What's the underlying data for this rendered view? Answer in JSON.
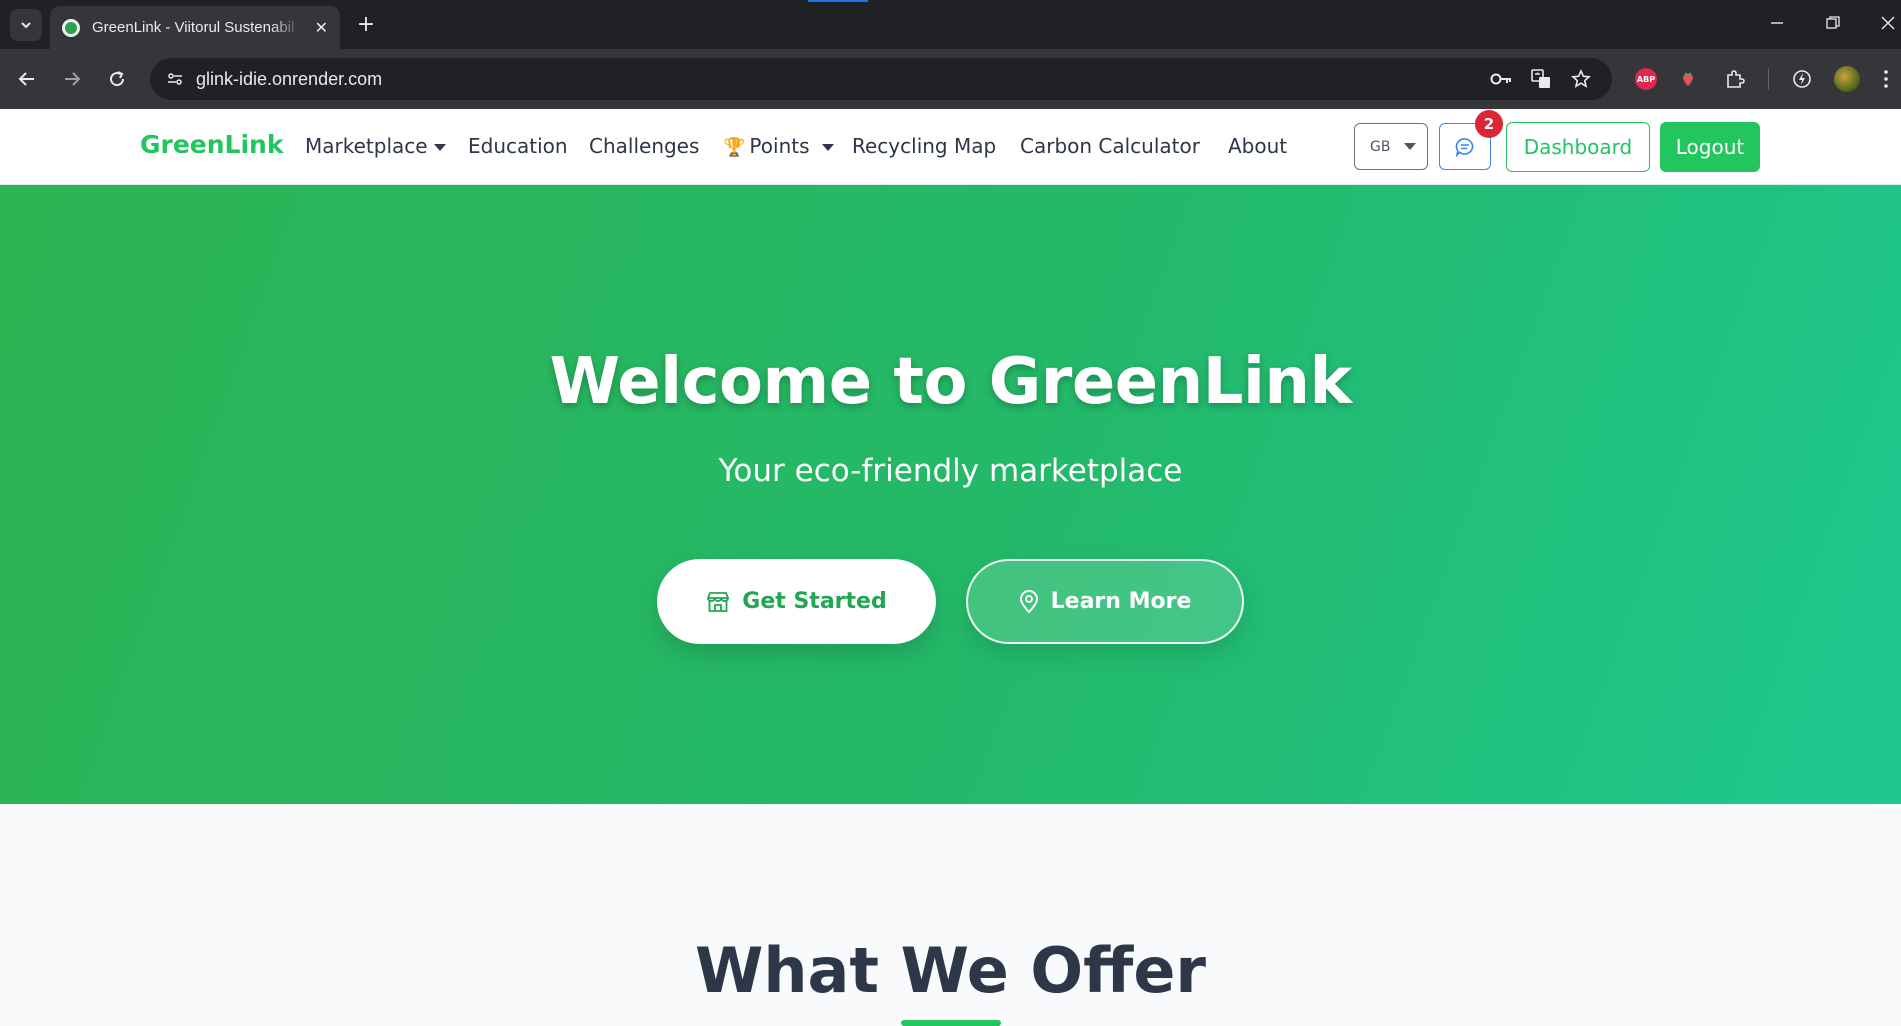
{
  "browser": {
    "tab_title": "GreenLink - Viitorul Sustenabil",
    "tab_close": "✕",
    "new_tab": "+",
    "url": "glink-idie.onrender.com",
    "extensions": {
      "abp_label": "ABP"
    }
  },
  "navbar": {
    "brand": "GreenLink",
    "links": {
      "marketplace": "Marketplace",
      "education": "Education",
      "challenges": "Challenges",
      "points": "Points",
      "recycling_map": "Recycling Map",
      "carbon_calculator": "Carbon Calculator",
      "about": "About"
    },
    "language": "GB",
    "chat_badge": "2",
    "dashboard": "Dashboard",
    "logout": "Logout"
  },
  "hero": {
    "title": "Welcome to GreenLink",
    "subtitle": "Your eco-friendly marketplace",
    "primary_button": "Get Started",
    "secondary_button": "Learn More"
  },
  "offer": {
    "title": "What We Offer"
  },
  "colors": {
    "brand_green": "#22c55e",
    "hero_gradient_start": "#2db454",
    "hero_gradient_end": "#1fc890",
    "badge_red": "#dc2635",
    "chat_blue": "#3b82f6"
  }
}
